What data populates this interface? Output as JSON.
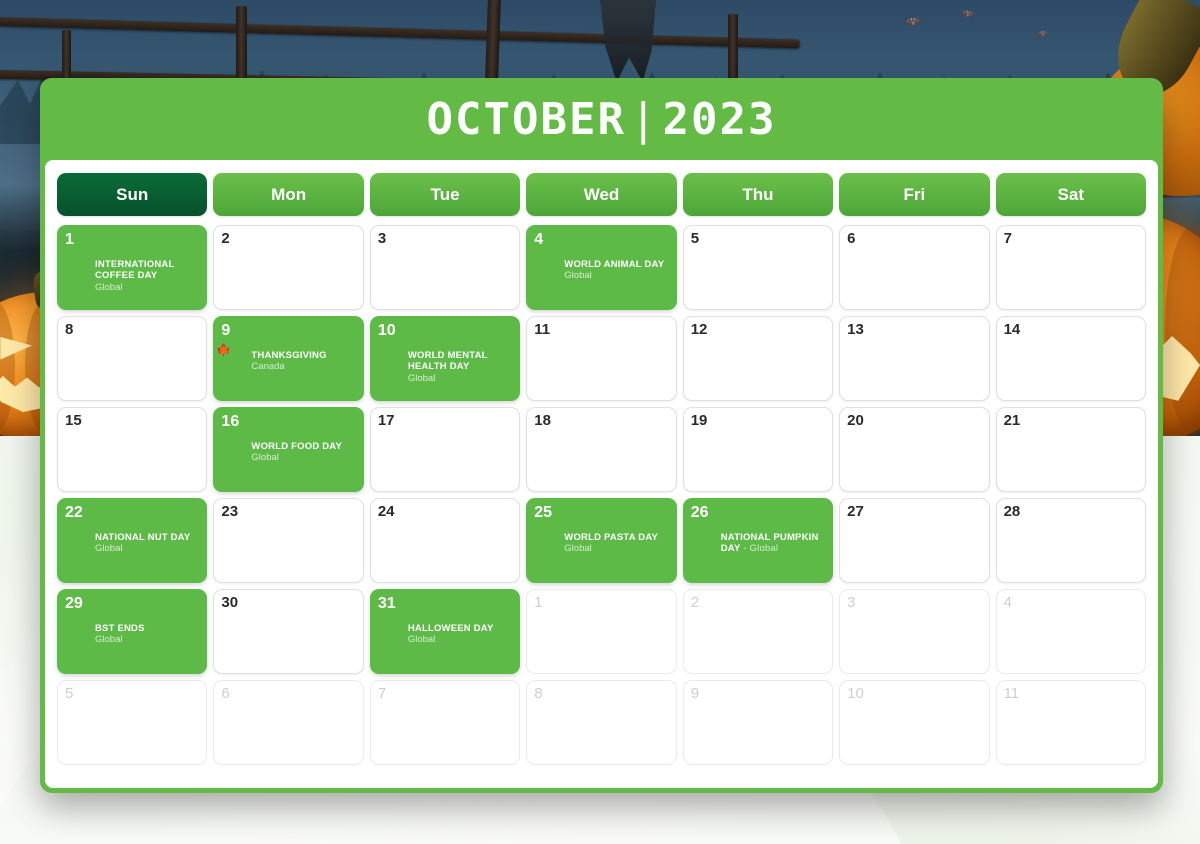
{
  "header": {
    "month": "OCTOBER",
    "separator": "|",
    "year": "2023"
  },
  "weekdays": [
    {
      "label": "Sun",
      "highlight": true
    },
    {
      "label": "Mon",
      "highlight": false
    },
    {
      "label": "Tue",
      "highlight": false
    },
    {
      "label": "Wed",
      "highlight": false
    },
    {
      "label": "Thu",
      "highlight": false
    },
    {
      "label": "Fri",
      "highlight": false
    },
    {
      "label": "Sat",
      "highlight": false
    }
  ],
  "colors": {
    "panel_green": "#63bb46",
    "event_green": "#5dba47",
    "sunday_dark_green": "#0b6b39",
    "header_gradient_top": "#6cc04a",
    "header_gradient_bottom": "#4ca637",
    "day_number": "#2b2b2b",
    "muted_day_number": "#cdcfcf",
    "event_scope_text": "#d8ecd0"
  },
  "weeks": [
    [
      {
        "num": "1",
        "state": "event",
        "event": {
          "name": "INTERNATIONAL COFFEE DAY",
          "scope": "Global",
          "icon": "globe-flags-icon",
          "inline": false
        }
      },
      {
        "num": "2",
        "state": "normal"
      },
      {
        "num": "3",
        "state": "normal"
      },
      {
        "num": "4",
        "state": "event",
        "event": {
          "name": "WORLD ANIMAL DAY",
          "scope": "Global",
          "icon": "globe-flags-icon",
          "inline": false
        }
      },
      {
        "num": "5",
        "state": "normal"
      },
      {
        "num": "6",
        "state": "normal"
      },
      {
        "num": "7",
        "state": "normal"
      }
    ],
    [
      {
        "num": "8",
        "state": "normal"
      },
      {
        "num": "9",
        "state": "event",
        "event": {
          "name": "THANKSGIVING",
          "scope": "Canada",
          "icon": "canada-flag-icon",
          "inline": false
        }
      },
      {
        "num": "10",
        "state": "event",
        "event": {
          "name": "WORLD MENTAL HEALTH DAY",
          "scope": "Global",
          "icon": "globe-flags-icon",
          "inline": false
        }
      },
      {
        "num": "11",
        "state": "normal"
      },
      {
        "num": "12",
        "state": "normal"
      },
      {
        "num": "13",
        "state": "normal"
      },
      {
        "num": "14",
        "state": "normal"
      }
    ],
    [
      {
        "num": "15",
        "state": "normal"
      },
      {
        "num": "16",
        "state": "event",
        "event": {
          "name": "WORLD FOOD DAY",
          "scope": "Global",
          "icon": "globe-flags-icon",
          "inline": false
        }
      },
      {
        "num": "17",
        "state": "normal"
      },
      {
        "num": "18",
        "state": "normal"
      },
      {
        "num": "19",
        "state": "normal"
      },
      {
        "num": "20",
        "state": "normal"
      },
      {
        "num": "21",
        "state": "normal"
      }
    ],
    [
      {
        "num": "22",
        "state": "event",
        "event": {
          "name": "NATIONAL NUT DAY",
          "scope": "Global",
          "icon": "globe-flags-icon",
          "inline": false
        }
      },
      {
        "num": "23",
        "state": "normal"
      },
      {
        "num": "24",
        "state": "normal"
      },
      {
        "num": "25",
        "state": "event",
        "event": {
          "name": "WORLD PASTA DAY",
          "scope": "Global",
          "icon": "globe-flags-icon",
          "inline": false
        }
      },
      {
        "num": "26",
        "state": "event",
        "event": {
          "name": "NATIONAL PUMPKIN DAY",
          "scope": "- Global",
          "icon": "globe-flags-icon",
          "inline": true
        }
      },
      {
        "num": "27",
        "state": "normal"
      },
      {
        "num": "28",
        "state": "normal"
      }
    ],
    [
      {
        "num": "29",
        "state": "event",
        "event": {
          "name": "BST ENDS",
          "scope": "Global",
          "icon": "globe-flags-icon",
          "inline": false
        }
      },
      {
        "num": "30",
        "state": "normal"
      },
      {
        "num": "31",
        "state": "event",
        "event": {
          "name": "HALLOWEEN DAY",
          "scope": "Global",
          "icon": "globe-flags-icon",
          "inline": false
        }
      },
      {
        "num": "1",
        "state": "muted"
      },
      {
        "num": "2",
        "state": "muted"
      },
      {
        "num": "3",
        "state": "muted"
      },
      {
        "num": "4",
        "state": "muted"
      }
    ],
    [
      {
        "num": "5",
        "state": "muted"
      },
      {
        "num": "6",
        "state": "muted"
      },
      {
        "num": "7",
        "state": "muted"
      },
      {
        "num": "8",
        "state": "muted"
      },
      {
        "num": "9",
        "state": "muted"
      },
      {
        "num": "10",
        "state": "muted"
      },
      {
        "num": "11",
        "state": "muted"
      }
    ]
  ],
  "background": {
    "theme": "halloween-pumpkins-foggy-forest"
  }
}
